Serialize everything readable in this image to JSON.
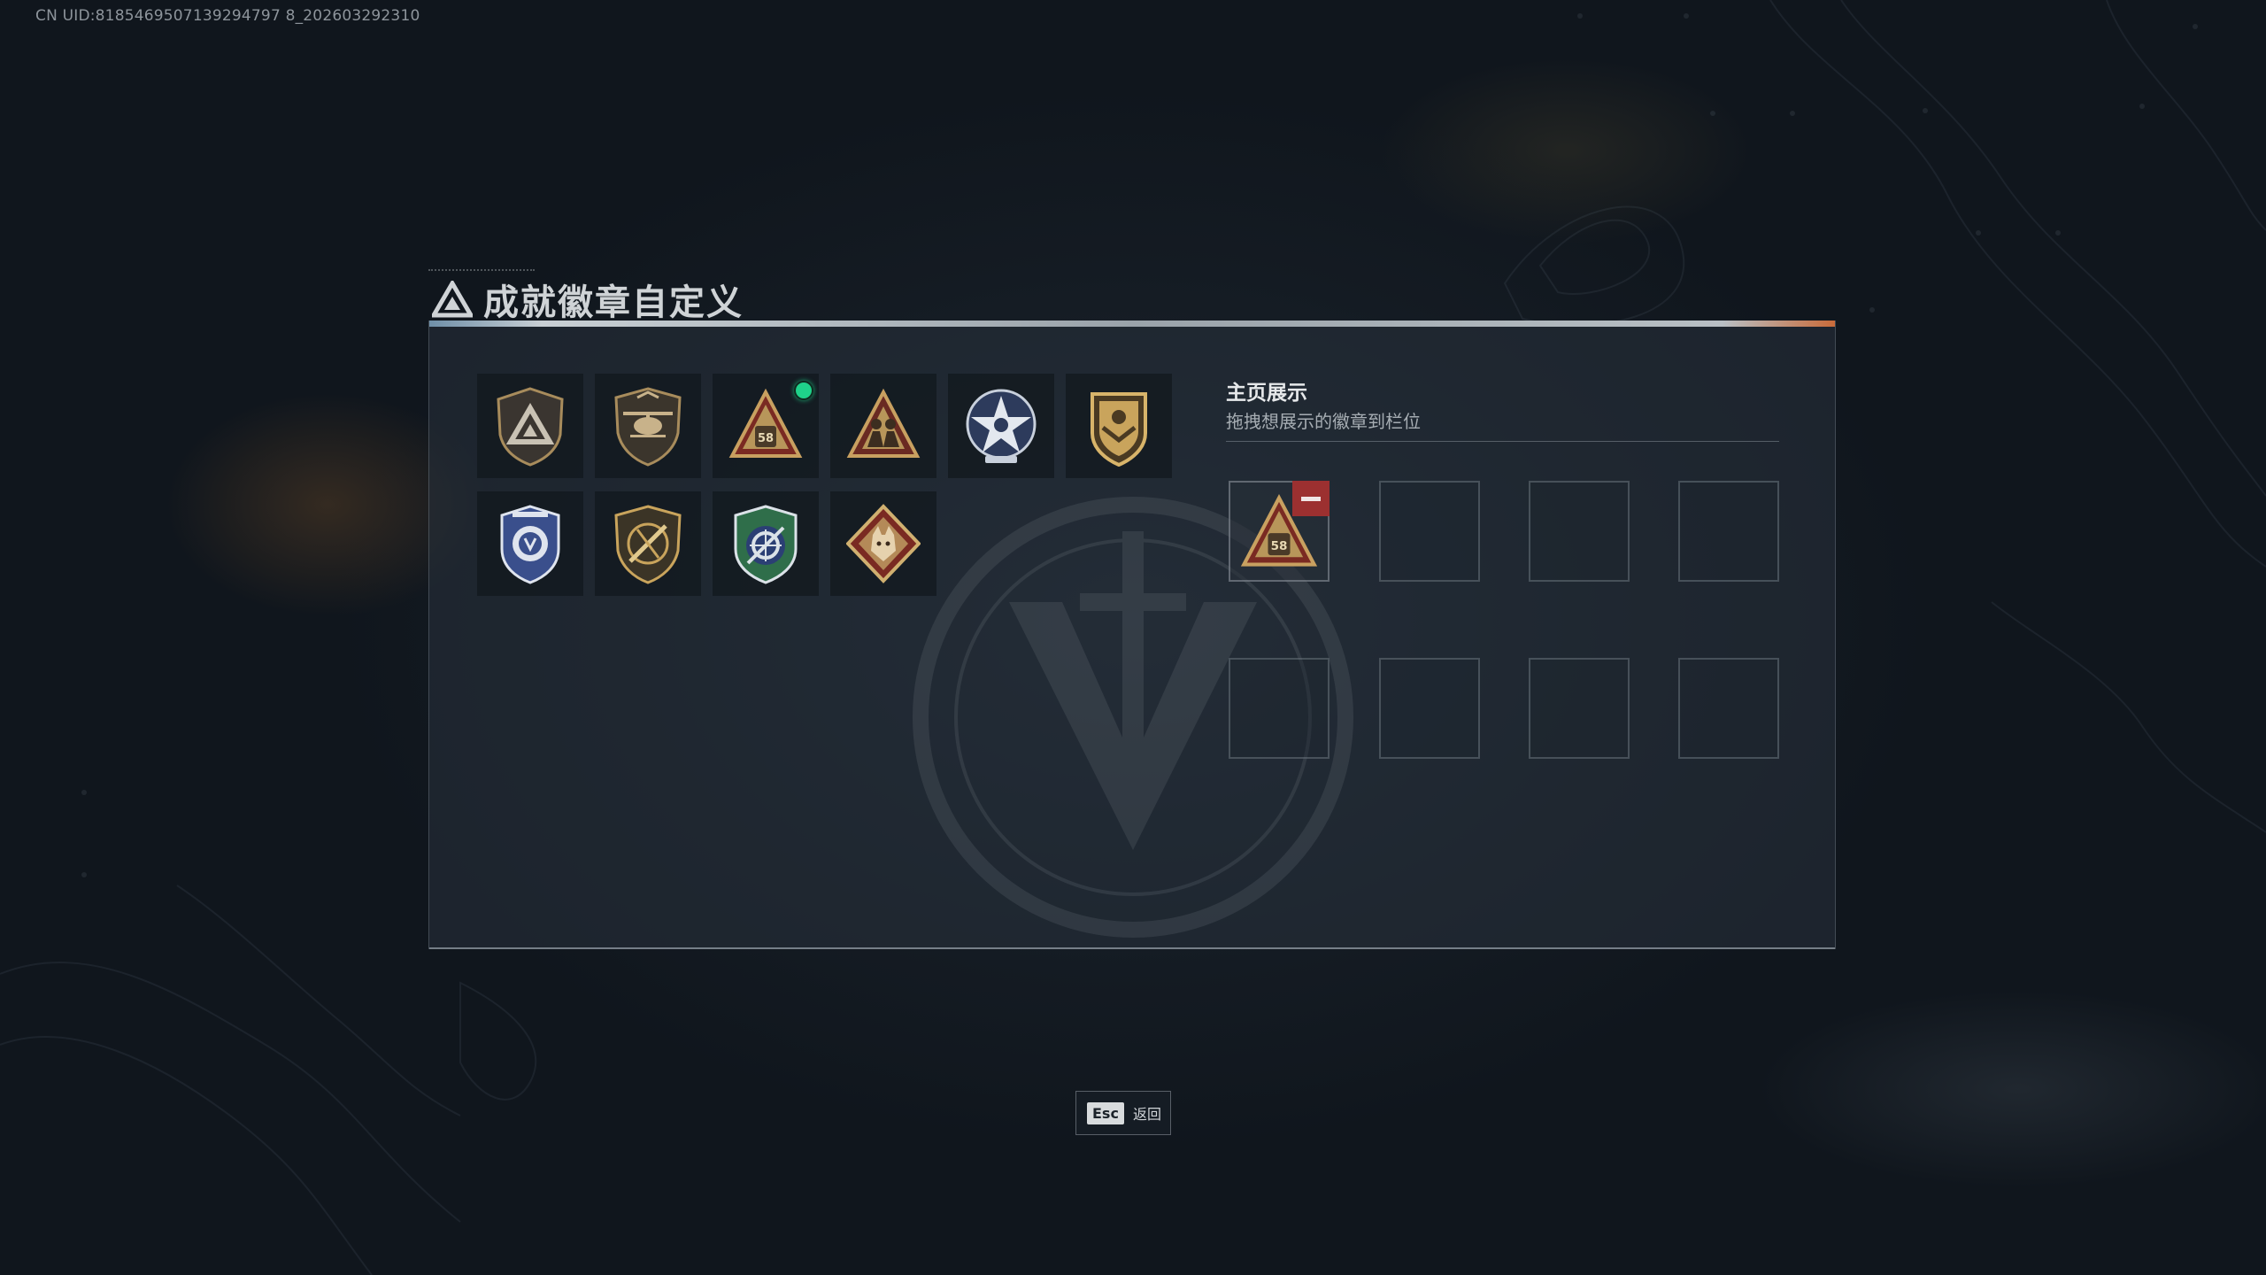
{
  "uid_text": "CN UID:8185469507139294797 8_202603292310",
  "window": {
    "title": "成就徽章自定义"
  },
  "badges": [
    {
      "name": "delta-triangle-shield-badge",
      "new": false
    },
    {
      "name": "helicopter-shield-badge",
      "new": false
    },
    {
      "name": "58-triangle-badge",
      "new": true
    },
    {
      "name": "soldiers-triangle-badge",
      "new": false
    },
    {
      "name": "star-round-badge",
      "new": false
    },
    {
      "name": "gold-chevron-shield-badge",
      "new": false
    },
    {
      "name": "blue-police-badge",
      "new": false
    },
    {
      "name": "crossed-rifle-shield-badge",
      "new": false
    },
    {
      "name": "green-crosshair-badge",
      "new": false
    },
    {
      "name": "wolf-diamond-badge",
      "new": false
    }
  ],
  "showcase": {
    "title": "主页展示",
    "subtitle": "拖拽想展示的徽章到栏位",
    "slots": [
      {
        "badge": "58-triangle-badge",
        "label": "58"
      },
      {
        "badge": null
      },
      {
        "badge": null
      },
      {
        "badge": null
      },
      {
        "badge": null
      },
      {
        "badge": null
      },
      {
        "badge": null
      },
      {
        "badge": null
      }
    ]
  },
  "footer": {
    "esc_key": "Esc",
    "esc_label": "返回"
  },
  "colors": {
    "new_indicator": "#1fd28a",
    "remove_button": "#9c3030",
    "badge_gold": "#b8965a",
    "badge_blue": "#3a4f8c"
  }
}
